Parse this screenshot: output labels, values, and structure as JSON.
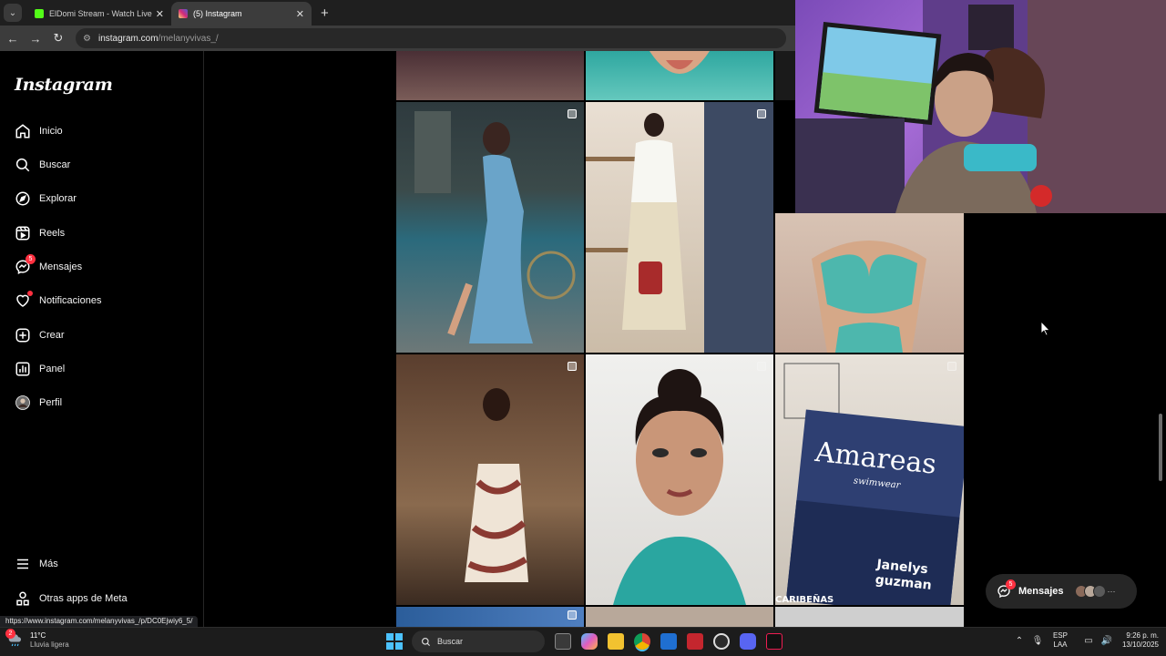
{
  "browser": {
    "tabs": [
      {
        "title": "ElDomi Stream - Watch Live on",
        "active": false,
        "favicon_color": "#53fc18"
      },
      {
        "title": "(5) Instagram",
        "active": true,
        "favicon_color": "#e1306c"
      }
    ],
    "url_host": "instagram.com",
    "url_path": "/melanyvivas_/"
  },
  "sidebar": {
    "logo": "Instagram",
    "items": [
      {
        "label": "Inicio",
        "icon": "home-icon"
      },
      {
        "label": "Buscar",
        "icon": "search-icon"
      },
      {
        "label": "Explorar",
        "icon": "compass-icon"
      },
      {
        "label": "Reels",
        "icon": "reels-icon"
      },
      {
        "label": "Mensajes",
        "icon": "messenger-icon",
        "badge": "5"
      },
      {
        "label": "Notificaciones",
        "icon": "heart-icon",
        "dot": true
      },
      {
        "label": "Crear",
        "icon": "plus-square-icon"
      },
      {
        "label": "Panel",
        "icon": "chart-icon"
      },
      {
        "label": "Perfil",
        "icon": "avatar-icon"
      }
    ],
    "bottom_items": [
      {
        "label": "Más",
        "icon": "hamburger-icon"
      },
      {
        "label": "Otras apps de Meta",
        "icon": "meta-apps-icon"
      }
    ]
  },
  "messages_pill": {
    "label": "Mensajes",
    "badge": "5",
    "more": "···"
  },
  "status_url": "https://www.instagram.com/melanyvivas_/p/DC0Ejwiy6_5/",
  "taskbar": {
    "weather_badge": "2",
    "temp": "11°C",
    "condition": "Lluvia ligera",
    "search_placeholder": "Buscar",
    "lang_top": "ESP",
    "lang_bottom": "LAA",
    "time": "9:26 p. m.",
    "date": "13/10/2025"
  },
  "colors": {
    "background": "#000000",
    "badge": "#ff3040",
    "sidebar_border": "#262626",
    "taskbar": "#1c1c1c"
  }
}
